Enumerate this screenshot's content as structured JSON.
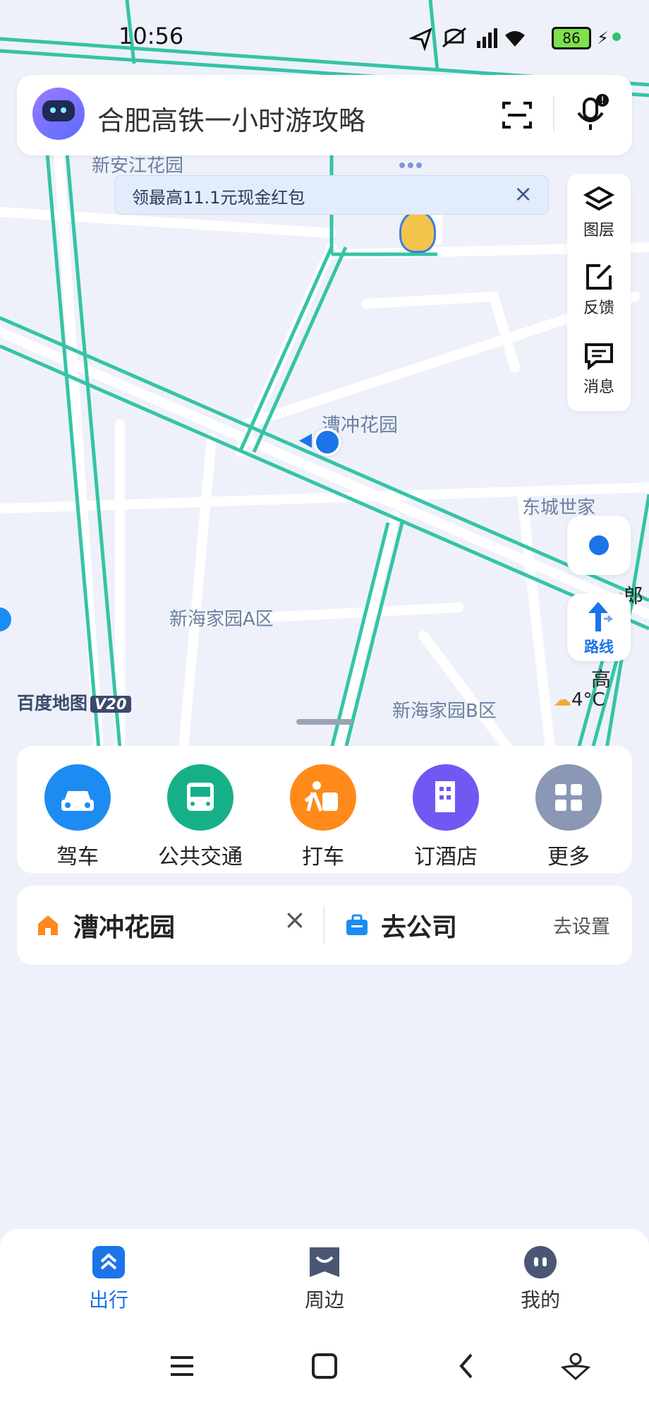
{
  "status_bar": {
    "time": "10:56",
    "battery": "86"
  },
  "search": {
    "placeholder": "合肥高铁一小时游攻略"
  },
  "promo": {
    "text": "领最高11.1元现金红包"
  },
  "map": {
    "labels": {
      "top_left": "新安江花园",
      "location": "漕冲花园",
      "east": "东城世家",
      "block_a": "新海家园A区",
      "block_b": "新海家园B区",
      "road1": "郎",
      "road2": "高"
    },
    "brand": "百度地图",
    "brand_version": "V20",
    "weather": "4°C"
  },
  "side_panel": {
    "layers": "图层",
    "feedback": "反馈",
    "messages": "消息"
  },
  "route_button": "路线",
  "quick_actions": [
    {
      "label": "驾车",
      "color": "#1c8cf2",
      "icon": "car-icon"
    },
    {
      "label": "公共交通",
      "color": "#16b088",
      "icon": "bus-icon"
    },
    {
      "label": "打车",
      "color": "#ff8a1a",
      "icon": "taxi-icon"
    },
    {
      "label": "订酒店",
      "color": "#7257f2",
      "icon": "hotel-icon"
    },
    {
      "label": "更多",
      "color": "#8a97b5",
      "icon": "grid-icon"
    }
  ],
  "home_work": {
    "home": "漕冲花园",
    "company": "去公司",
    "setup": "去设置"
  },
  "bottom_nav": {
    "travel": "出行",
    "nearby": "周边",
    "mine": "我的"
  },
  "colors": {
    "accent": "#1c74e8",
    "road": "#35c4a5"
  }
}
